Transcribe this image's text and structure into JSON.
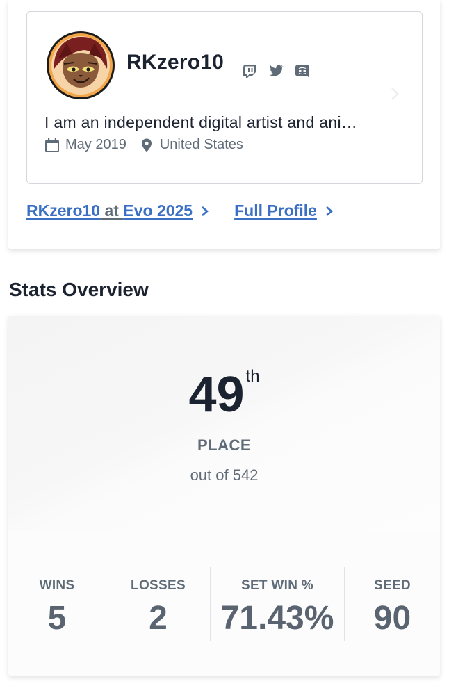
{
  "profile": {
    "username": "RKzero10",
    "bio": "I am an independent digital artist and ani…",
    "joined": "May 2019",
    "location": "United States",
    "socials": [
      "twitch-icon",
      "twitter-icon",
      "discord-icon"
    ]
  },
  "links": {
    "event_user": "RKzero10",
    "event_at": "at",
    "event_name": "Evo 2025",
    "full_profile": "Full Profile"
  },
  "section_title": "Stats Overview",
  "placement": {
    "number": "49",
    "suffix": "th",
    "label": "PLACE",
    "out_of": "out of 542"
  },
  "stats": [
    {
      "label": "WINS",
      "value": "5"
    },
    {
      "label": "LOSSES",
      "value": "2"
    },
    {
      "label": "SET WIN %",
      "value": "71.43%"
    },
    {
      "label": "SEED",
      "value": "90"
    }
  ],
  "colors": {
    "link": "#3a6fc4",
    "text": "#1b2330",
    "muted": "#5f6b77"
  }
}
